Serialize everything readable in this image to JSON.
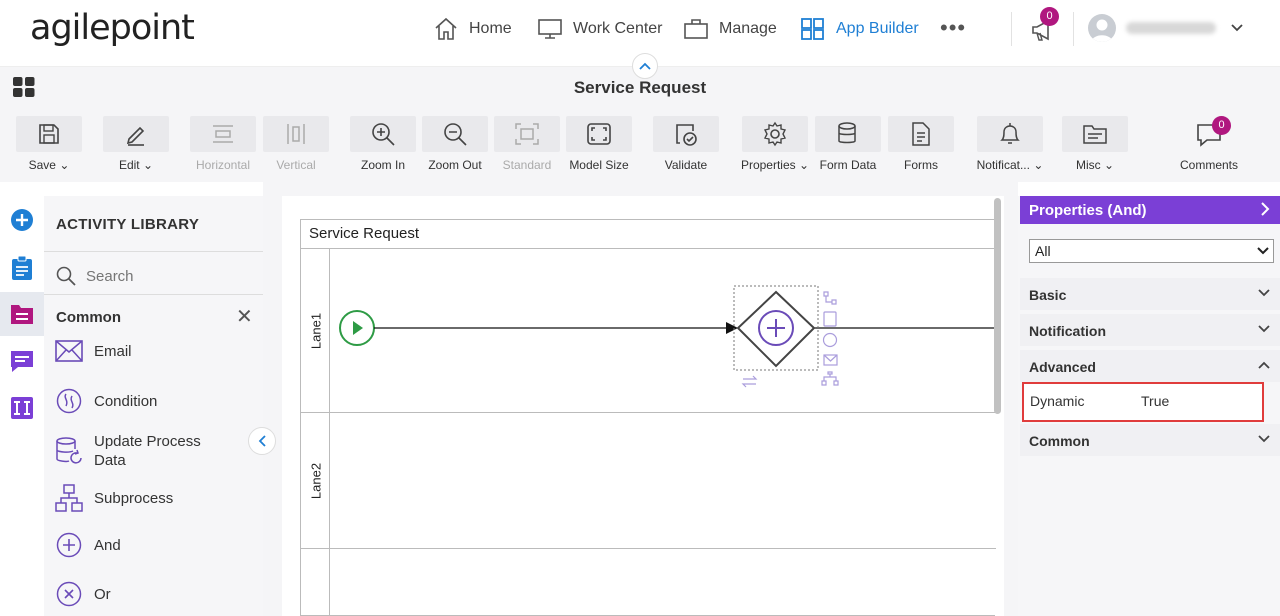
{
  "header": {
    "logo": "agilepoint",
    "nav": [
      {
        "label": "Home",
        "icon": "home-icon"
      },
      {
        "label": "Work Center",
        "icon": "monitor-icon"
      },
      {
        "label": "Manage",
        "icon": "briefcase-icon"
      },
      {
        "label": "App Builder",
        "icon": "grid-icon",
        "active": true
      }
    ],
    "more": "•••",
    "announcements_count": "0"
  },
  "page": {
    "title": "Service Request"
  },
  "toolbar": {
    "items": [
      {
        "label": "Save",
        "icon": "save-icon",
        "dropdown": true
      },
      {
        "label": "Edit",
        "icon": "pencil-icon",
        "dropdown": true
      },
      {
        "label": "Horizontal",
        "icon": "horizontal-icon",
        "disabled": true
      },
      {
        "label": "Vertical",
        "icon": "vertical-icon",
        "disabled": true
      },
      {
        "label": "Zoom In",
        "icon": "zoom-in-icon"
      },
      {
        "label": "Zoom Out",
        "icon": "zoom-out-icon"
      },
      {
        "label": "Standard",
        "icon": "standard-icon",
        "disabled": true
      },
      {
        "label": "Model Size",
        "icon": "model-size-icon"
      },
      {
        "label": "Validate",
        "icon": "validate-icon"
      },
      {
        "label": "Properties",
        "icon": "gear-icon",
        "dropdown": true
      },
      {
        "label": "Form Data",
        "icon": "database-icon"
      },
      {
        "label": "Forms",
        "icon": "forms-icon"
      },
      {
        "label": "Notificat...",
        "icon": "bell-icon",
        "dropdown": true
      },
      {
        "label": "Misc",
        "icon": "folder-icon",
        "dropdown": true
      }
    ],
    "comments": {
      "label": "Comments",
      "count": "0"
    }
  },
  "library": {
    "title": "ACTIVITY LIBRARY",
    "search_placeholder": "Search",
    "category": "Common",
    "close": "✕",
    "activities": [
      {
        "label": "Email",
        "icon": "email-icon"
      },
      {
        "label": "Condition",
        "icon": "condition-icon"
      },
      {
        "label": "Update Process Data",
        "icon": "update-data-icon"
      },
      {
        "label": "Subprocess",
        "icon": "subprocess-icon"
      },
      {
        "label": "And",
        "icon": "and-icon"
      },
      {
        "label": "Or",
        "icon": "or-icon"
      }
    ]
  },
  "canvas": {
    "pool_title": "Service Request",
    "lanes": [
      "Lane1",
      "Lane2"
    ]
  },
  "properties": {
    "title": "Properties (And)",
    "filter": "All",
    "sections": [
      "Basic",
      "Notification",
      "Advanced",
      "Common"
    ],
    "advanced": {
      "key": "Dynamic",
      "value": "True"
    }
  },
  "colors": {
    "accent_blue": "#1f7fd4",
    "purple": "#7b3fd6",
    "badge": "#b0177f",
    "start_green": "#2e9b45",
    "highlight_red": "#e03c3c"
  }
}
